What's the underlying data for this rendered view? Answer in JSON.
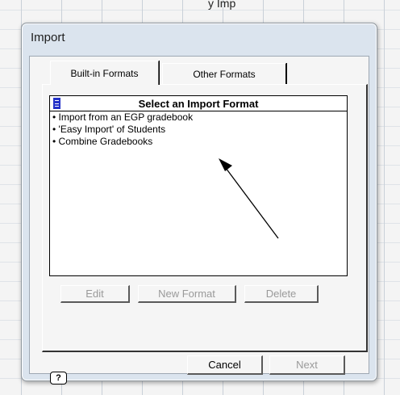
{
  "background": {
    "partial_text": "y Imp"
  },
  "dialog": {
    "title": "Import",
    "tabs": [
      {
        "label": "Built-in Formats",
        "active": true
      },
      {
        "label": "Other Formats",
        "active": false
      }
    ],
    "list": {
      "header": "Select an Import Format",
      "items": [
        "• Import from an EGP gradebook",
        "• 'Easy Import' of Students",
        "• Combine Gradebooks"
      ]
    },
    "panel_buttons": {
      "edit": "Edit",
      "new_format": "New Format",
      "delete": "Delete"
    },
    "footer": {
      "help": "?",
      "cancel": "Cancel",
      "next": "Next"
    }
  },
  "colors": {
    "dialog_frame": "#dbe4ee",
    "panel": "#f5f5f5",
    "header_icon": "#2432c8",
    "disabled_text": "#9a9a9a"
  }
}
